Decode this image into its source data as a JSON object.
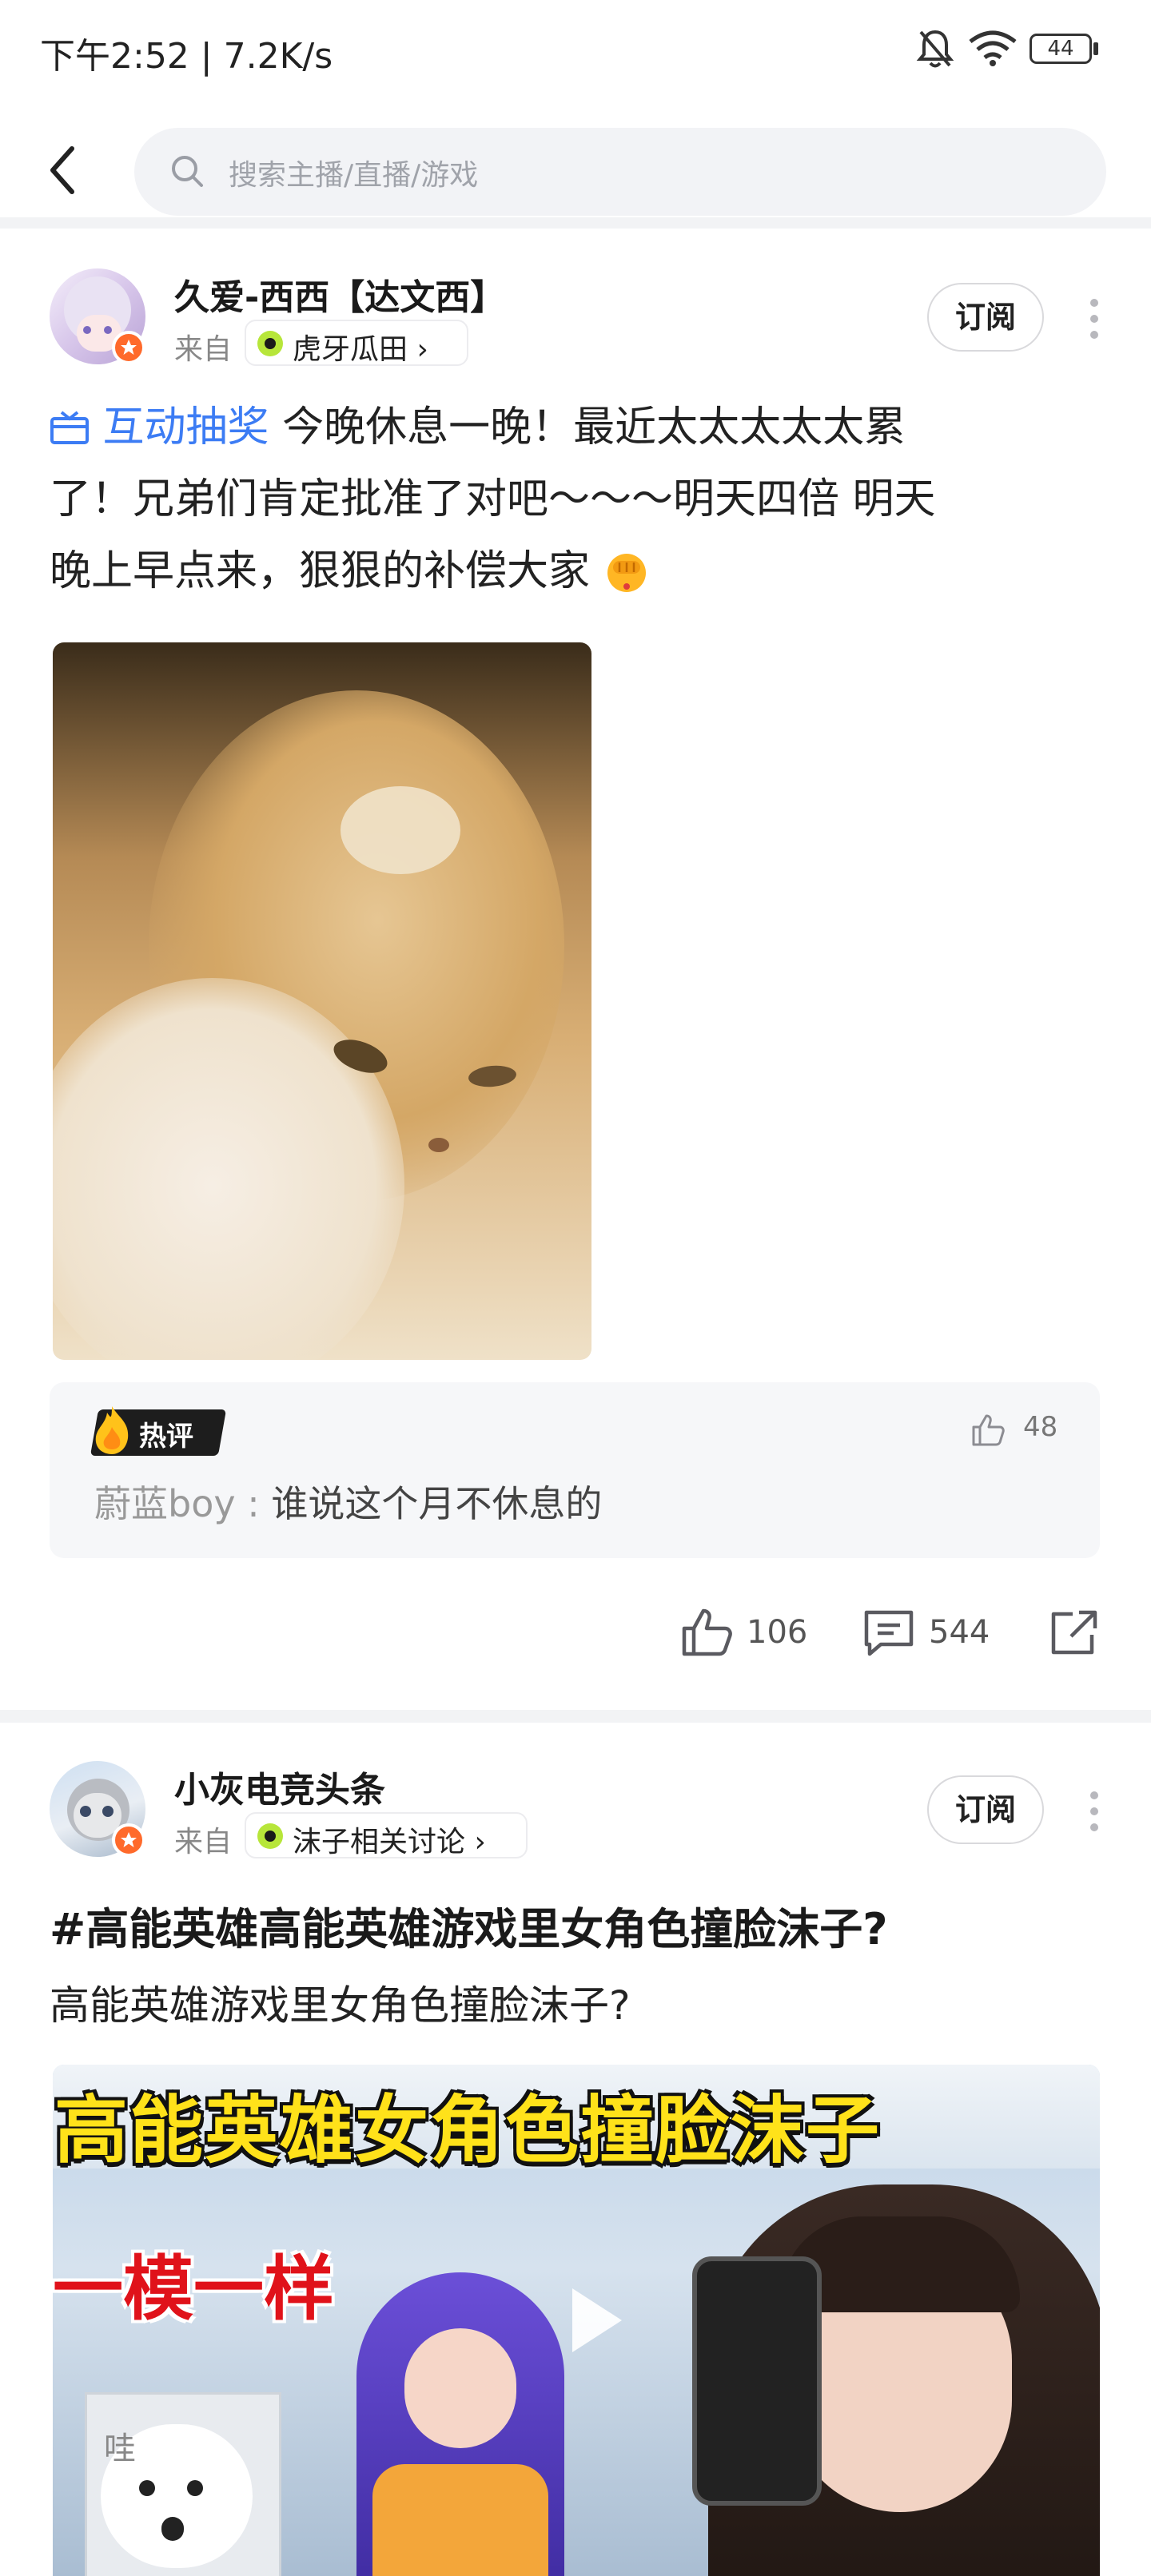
{
  "status_bar": {
    "time": "下午2:52 | 7.2K/s",
    "battery": "44",
    "icons": [
      "mute-bell-icon",
      "wifi-icon",
      "battery-icon"
    ]
  },
  "search": {
    "placeholder": "搜索主播/直播/游戏",
    "back_icon": "back-arrow-icon",
    "search_icon": "search-icon"
  },
  "posts": [
    {
      "author": "久爱-西西【达文西】",
      "from_label": "来自",
      "channel": "虎牙瓜田",
      "subscribe": "订阅",
      "tag": "互动抽奖",
      "text_line1": "今晚休息一晚！最近太太太太太累",
      "text_line2": "了！兄弟们肯定批准了对吧～～～明天四倍 明天",
      "text_line3": "晚上早点来，狠狠的补偿大家",
      "hot_comment": {
        "badge": "热评",
        "user": "蔚蓝boy",
        "separator": " : ",
        "text": "谁说这个月不休息的",
        "likes": "48"
      },
      "actions": {
        "likes": "106",
        "comments": "544"
      }
    },
    {
      "author": "小灰电竞头条",
      "from_label": "来自",
      "channel": "沫子相关讨论",
      "subscribe": "订阅",
      "title": "#高能英雄高能英雄游戏里女角色撞脸沫子?",
      "text": "高能英雄游戏里女角色撞脸沫子?",
      "video_title": "高能英雄女角色撞脸沫子",
      "video_subtitle": "一模一样",
      "video_sticker": "哇"
    }
  ],
  "colors": {
    "accent_blue": "#3c7cf4",
    "badge_orange": "#ff6a2b",
    "hot_yellow": "#ffd21f"
  }
}
